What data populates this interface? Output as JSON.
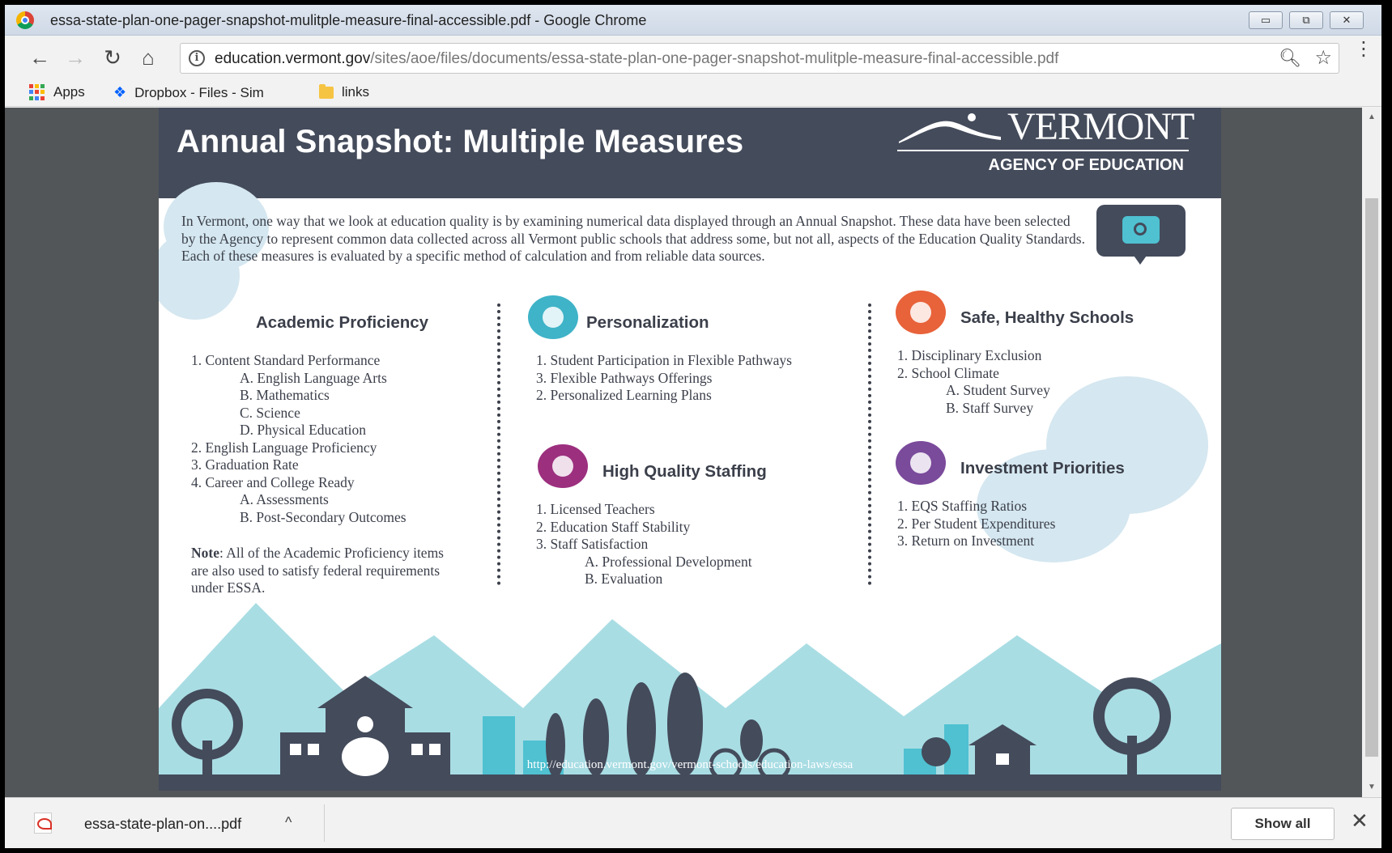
{
  "window": {
    "title": "essa-state-plan-one-pager-snapshot-mulitple-measure-final-accessible.pdf - Google Chrome",
    "controls": {
      "minimize": "▭",
      "maximize": "⧉",
      "close": "✕"
    }
  },
  "toolbar": {
    "back": "←",
    "forward": "→",
    "reload": "↻",
    "home": "⌂",
    "url_host": "education.vermont.gov",
    "url_path": "/sites/aoe/files/documents/essa-state-plan-one-pager-snapshot-mulitple-measure-final-accessible.pdf",
    "zoom_icon": "search-icon",
    "star_icon": "star-icon",
    "menu": "⋮"
  },
  "bookmarks": [
    {
      "label": "Apps",
      "icon": "apps-grid-icon"
    },
    {
      "label": "Dropbox - Files - Sim",
      "icon": "dropbox-icon"
    },
    {
      "label": "links",
      "icon": "folder-icon"
    }
  ],
  "doc": {
    "title": "Annual Snapshot: Multiple Measures",
    "logo_name": "VERMONT",
    "logo_sub": "AGENCY OF EDUCATION",
    "intro": "In Vermont, one way that we look at education quality is by examining numerical data displayed through an Annual Snapshot. These data have been selected by the Agency to represent common data collected across all Vermont public schools that address some, but not all, aspects of the Education Quality Standards. Each of these measures is evaluated by a specific method of calculation and from reliable data sources.",
    "academic": {
      "title": "Academic Proficiency",
      "items": [
        "1. Content Standard Performance",
        "A. English Language Arts",
        "B. Mathematics",
        "C. Science",
        "D. Physical Education",
        "2. English Language Proficiency",
        "3. Graduation Rate",
        "4. Career and College Ready",
        "A. Assessments",
        "B. Post-Secondary Outcomes"
      ],
      "note_label": "Note",
      "note_text": ": All of the Academic Proficiency items are also used to satisfy federal requirements under ESSA."
    },
    "personalization": {
      "title": "Personalization",
      "items": [
        "1. Student Participation in Flexible Pathways",
        "3. Flexible Pathways Offerings",
        "2. Personalized Learning Plans"
      ]
    },
    "staffing": {
      "title": "High Quality Staffing",
      "items": [
        "1. Licensed Teachers",
        "2. Education Staff Stability",
        "3. Staff Satisfaction",
        "A. Professional Development",
        "B. Evaluation"
      ]
    },
    "safe": {
      "title": "Safe, Healthy Schools",
      "items": [
        "1. Disciplinary Exclusion",
        "2. School Climate",
        "A. Student Survey",
        "B. Staff Survey"
      ]
    },
    "investment": {
      "title": "Investment Priorities",
      "items": [
        "1. EQS Staffing Ratios",
        "2. Per Student Expenditures",
        "3. Return on Investment"
      ]
    },
    "footer_url": "http://education.vermont.gov/vermont-schools/education-laws/essa"
  },
  "colors": {
    "header_bg": "#444b5b",
    "personalization_icon": "#3fb3c8",
    "safe_icon": "#e8623a",
    "staffing_icon": "#9c2f7e",
    "investment_icon": "#7a4a9b",
    "mountains": "#a9dde4",
    "silhouettes": "#444b5b"
  },
  "downloads": {
    "file_name": "essa-state-plan-on....pdf",
    "caret": "^",
    "show_all": "Show all",
    "close": "✕"
  }
}
